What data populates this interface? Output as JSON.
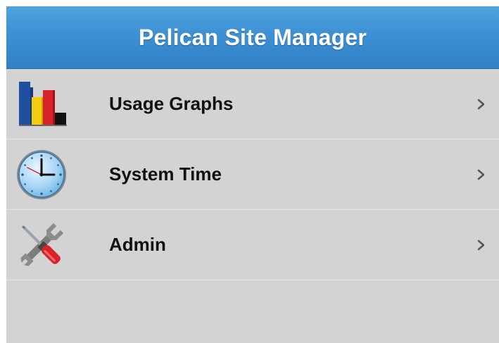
{
  "header": {
    "title": "Pelican Site Manager",
    "gradient_top": "#4ea3e0",
    "gradient_bottom": "#2f7fc4"
  },
  "menu": {
    "items": [
      {
        "label": "Usage Graphs",
        "icon": "bar-chart-icon"
      },
      {
        "label": "System Time",
        "icon": "clock-icon"
      },
      {
        "label": "Admin",
        "icon": "tools-icon"
      }
    ]
  },
  "colors": {
    "list_background": "#d3d3d3",
    "divider": "#e6e6e6",
    "label_text": "#111111",
    "chevron": "#555555"
  }
}
